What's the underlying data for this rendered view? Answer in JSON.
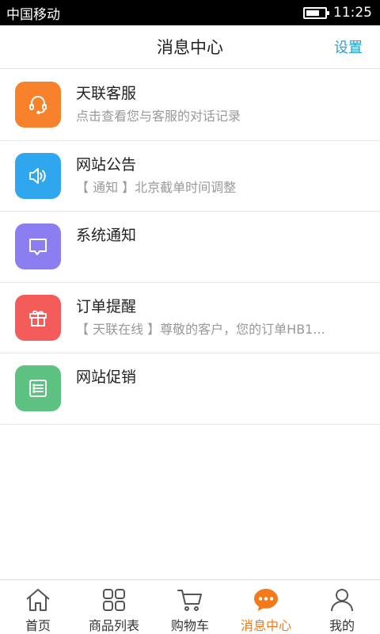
{
  "status_bar": {
    "carrier": "中国移动",
    "time": "11:25"
  },
  "header": {
    "title": "消息中心",
    "settings_label": "设置"
  },
  "colors": {
    "accent": "#f27a1a",
    "link": "#2a9fd8"
  },
  "messages": [
    {
      "title": "天联客服",
      "subtitle": "点击查看您与客服的对话记录",
      "icon": "headset-icon",
      "color": "#f7822b"
    },
    {
      "title": "网站公告",
      "subtitle": "【 通知 】北京截单时间调整",
      "icon": "speaker-icon",
      "color": "#2fa6ee"
    },
    {
      "title": "系统通知",
      "subtitle": "",
      "icon": "chat-bubble-icon",
      "color": "#8b7ef0"
    },
    {
      "title": "订单提醒",
      "subtitle": "【 天联在线 】尊敬的客户，您的订单HB1...",
      "icon": "gift-icon",
      "color": "#f45c5c"
    },
    {
      "title": "网站促销",
      "subtitle": "",
      "icon": "list-icon",
      "color": "#5dc281"
    }
  ],
  "tabs": [
    {
      "label": "首页",
      "icon": "home-icon",
      "active": false
    },
    {
      "label": "商品列表",
      "icon": "grid-icon",
      "active": false
    },
    {
      "label": "购物车",
      "icon": "cart-icon",
      "active": false
    },
    {
      "label": "消息中心",
      "icon": "message-icon",
      "active": true
    },
    {
      "label": "我的",
      "icon": "user-icon",
      "active": false
    }
  ]
}
